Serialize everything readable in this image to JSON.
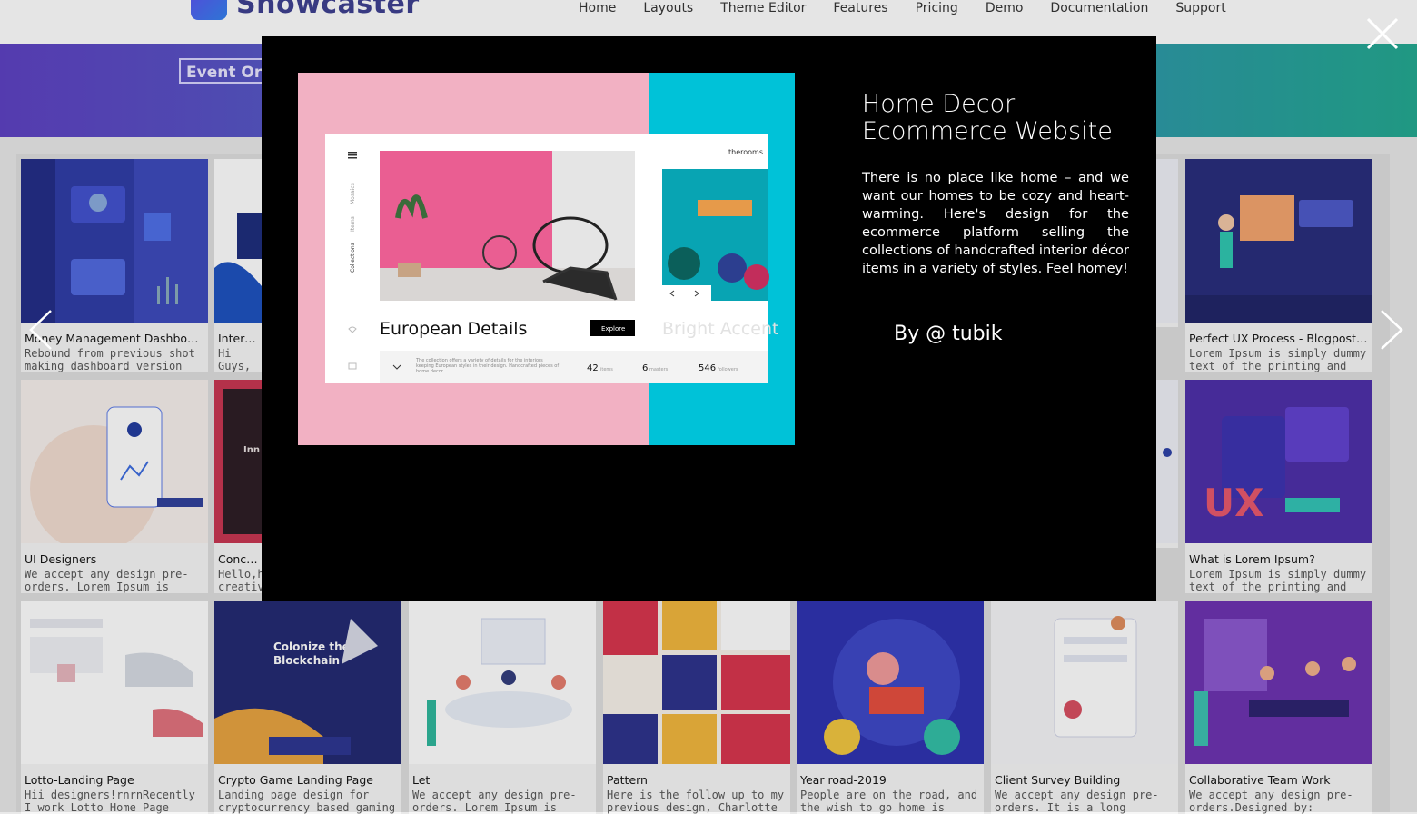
{
  "nav": {
    "logo": "Showcaster",
    "items": [
      "Home",
      "Layouts",
      "Theme Editor",
      "Features",
      "Pricing",
      "Demo",
      "Documentation",
      "Support"
    ]
  },
  "hero": {
    "button_label": "Event Or"
  },
  "cards": [
    {
      "title": "Money Management Dashboard",
      "desc": "Rebound from previous shot making dashboard version with",
      "accent": "#3a3fb5"
    },
    {
      "title": "Internet",
      "desc": "Hi Guys, the seat",
      "accent": "#ffffff"
    },
    {
      "title": "Perfect UX Process - Blogpost ...",
      "desc": "Lorem Ipsum is simply dummy text of the printing and",
      "accent": "#2a2f86"
    },
    {
      "title": "UI Designers",
      "desc": "We accept any design pre-orders. Lorem Ipsum is simply",
      "accent": "#f4e7df"
    },
    {
      "title": "Conceptu",
      "desc": "Hello,he creative",
      "accent": "#c23a56"
    },
    {
      "title": "What is Lorem Ipsum?",
      "desc": "Lorem Ipsum is simply dummy text of the printing and",
      "accent": "#4b2ca8"
    },
    {
      "title": "Lotto-Landing Page",
      "desc": "Hii designers!rnrnRecently I work Lotto Home Page concept.",
      "accent": "#f2f3f7"
    },
    {
      "title": "Crypto Game Landing Page",
      "desc": "Landing page design for cryptocurrency based gaming",
      "accent": "#22297a"
    },
    {
      "title": "Let",
      "desc": "We accept any design pre-orders. Lorem Ipsum is simply",
      "accent": "#f4f4f4"
    },
    {
      "title": "Pattern",
      "desc": "Here is the follow up to my previous design, Charlotte Art",
      "accent": "#d8324b"
    },
    {
      "title": "Year road-2019",
      "desc": "People are on the road, and the wish to go home is always in",
      "accent": "#2b2fb0"
    },
    {
      "title": "Client Survey Building",
      "desc": "We accept any design pre-orders. It is a long established",
      "accent": "#f3f3f6"
    },
    {
      "title": "Collaborative Team Work",
      "desc": "We accept any design pre-orders.Designed by:",
      "accent": "#6a2fb0"
    }
  ],
  "modal": {
    "title_line1": "Home Decor",
    "title_line2": "Ecommerce Website",
    "description": "There is no place like home – and we want our homes to be cozy and heart-warming. Here's design for the ecommerce platform selling the collections of handcrafted interior décor items in a variety of styles. Feel homey!",
    "author": "By @ tubik",
    "image": {
      "brand": "therooms.",
      "nav_items": [
        "Mosaics",
        "Items",
        "Collections"
      ],
      "heading": "European Details",
      "button": "Explore",
      "next_heading": "Bright Accent",
      "blurb": "The collection offers a variety of details for the interiors keeping European styles in their design. Handcrafted pieces of home decor.",
      "stat1_value": "42",
      "stat1_label": "items",
      "stat2_value": "6",
      "stat2_label": "masters",
      "stat3_value": "546",
      "stat3_label": "followers"
    }
  },
  "colors": {
    "pink": "#f2b1c3",
    "cyan": "#00c2d8",
    "modal_bg": "#000000"
  }
}
